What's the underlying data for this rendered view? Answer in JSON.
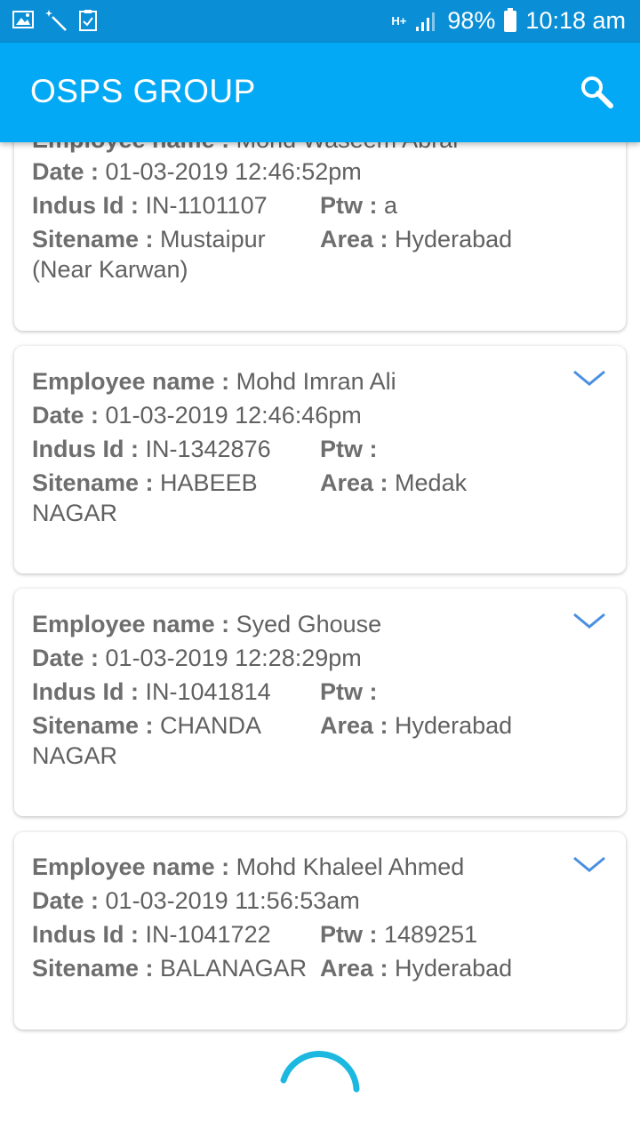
{
  "status_bar": {
    "network": "H+",
    "battery_percent": "98%",
    "time": "10:18 am"
  },
  "app_bar": {
    "title": "OSPS GROUP",
    "search_icon": "search-icon"
  },
  "labels": {
    "employee": "Employee name : ",
    "date": "Date : ",
    "indus": "Indus Id : ",
    "ptw": "Ptw : ",
    "sitename": "Sitename : ",
    "area": "Area : "
  },
  "cards": [
    {
      "employee": "Mohd Waseem Abrar",
      "date": "01-03-2019 12:46:52pm",
      "indus_id": "IN-1101107",
      "ptw": "a",
      "sitename": "Mustaipur (Near Karwan)",
      "area": "Hyderabad"
    },
    {
      "employee": "Mohd Imran Ali",
      "date": "01-03-2019 12:46:46pm",
      "indus_id": "IN-1342876",
      "ptw": "",
      "sitename": "HABEEB NAGAR",
      "area": "Medak"
    },
    {
      "employee": "Syed Ghouse",
      "date": "01-03-2019 12:28:29pm",
      "indus_id": "IN-1041814",
      "ptw": "",
      "sitename": "CHANDA NAGAR",
      "area": "Hyderabad"
    },
    {
      "employee": "Mohd Khaleel Ahmed",
      "date": "01-03-2019 11:56:53am",
      "indus_id": "IN-1041722",
      "ptw": "1489251",
      "sitename": "BALANAGAR",
      "area": "Hyderabad"
    }
  ],
  "colors": {
    "app_bar": "#03a9f4",
    "status_bar": "#0a8fd6",
    "accent": "#2aa9e8",
    "chevron": "#4a90e2"
  }
}
